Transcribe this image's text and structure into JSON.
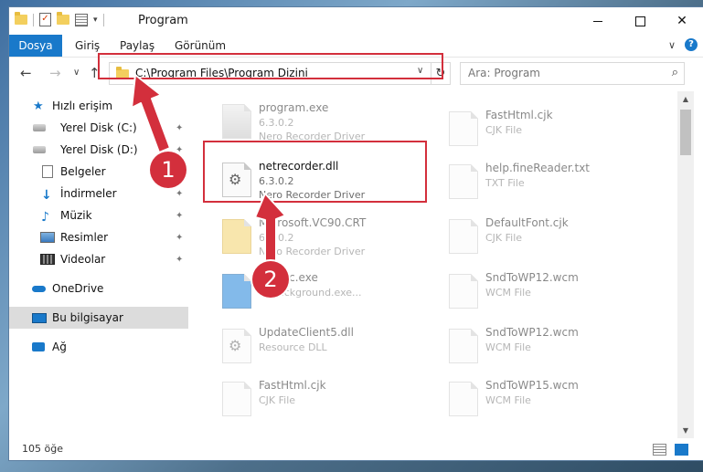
{
  "window": {
    "title": "Program",
    "minimize": "—",
    "maximize": "☐",
    "close": "✕"
  },
  "ribbon": {
    "tabs": [
      "Dosya",
      "Giriş",
      "Paylaş",
      "Görünüm"
    ],
    "expand": "∨",
    "help": "?"
  },
  "address": {
    "path": "C:\\Program Files\\Program Dizini",
    "back": "←",
    "forward": "→",
    "recent": "∨",
    "up": "↑",
    "refresh": "↻"
  },
  "search": {
    "placeholder": "Ara: Program"
  },
  "sidebar": {
    "items": [
      {
        "label": "Hızlı erişim",
        "icon": "star-icon"
      },
      {
        "label": "Yerel Disk (C:)",
        "icon": "disk-icon",
        "pinned": true
      },
      {
        "label": "Yerel Disk (D:)",
        "icon": "disk-icon",
        "pinned": true
      },
      {
        "label": "Belgeler",
        "icon": "document-icon",
        "pinned": true
      },
      {
        "label": "İndirmeler",
        "icon": "download-icon",
        "pinned": true
      },
      {
        "label": "Müzik",
        "icon": "music-icon",
        "pinned": true
      },
      {
        "label": "Resimler",
        "icon": "pictures-icon",
        "pinned": true
      },
      {
        "label": "Videolar",
        "icon": "video-icon",
        "pinned": true
      },
      {
        "label": "OneDrive",
        "icon": "cloud-icon"
      },
      {
        "label": "Bu bilgisayar",
        "icon": "computer-icon",
        "selected": true
      },
      {
        "label": "Ağ",
        "icon": "network-icon"
      }
    ],
    "pin_glyph": "📌"
  },
  "files": {
    "left": [
      {
        "name": "program.exe",
        "line2": "6.3.0.2",
        "line3": "Nero Recorder Driver",
        "icon": "exe-icon"
      },
      {
        "name": "netrecorder.dll",
        "line2": "6.3.0.2",
        "line3": "Nero Recorder Driver",
        "icon": "gear-file-icon",
        "highlighted": true
      },
      {
        "name": "Microsoft.VC90.CRT",
        "line2": "6.3.0.2",
        "line3": "Nero Recorder Driver",
        "icon": "folder-icon"
      },
      {
        "name": "...Exec.exe",
        "line2": "... background.exe...",
        "line3": "",
        "icon": "blue-app-icon"
      },
      {
        "name": "UpdateClient5.dll",
        "line2": "Resource DLL",
        "line3": "",
        "icon": "gear-file-icon"
      },
      {
        "name": "FastHtml.cjk",
        "line2": "CJK File",
        "line3": "",
        "icon": "file-icon"
      }
    ],
    "right": [
      {
        "name": "FastHtml.cjk",
        "line2": "CJK File",
        "icon": "file-icon"
      },
      {
        "name": "help.fineReader.txt",
        "line2": "TXT File",
        "icon": "file-icon"
      },
      {
        "name": "DefaultFont.cjk",
        "line2": "CJK File",
        "icon": "file-icon"
      },
      {
        "name": "SndToWP12.wcm",
        "line2": "WCM File",
        "icon": "file-icon"
      },
      {
        "name": "SndToWP12.wcm",
        "line2": "WCM File",
        "icon": "file-icon"
      },
      {
        "name": "SndToWP15.wcm",
        "line2": "WCM File",
        "icon": "file-icon"
      }
    ]
  },
  "status": {
    "count": "105 öğe"
  },
  "annotations": {
    "step1": "1",
    "step2": "2",
    "accent": "#d32f3c"
  },
  "colors": {
    "file_tab": "#1979ca",
    "highlight": "#d32f3c"
  }
}
